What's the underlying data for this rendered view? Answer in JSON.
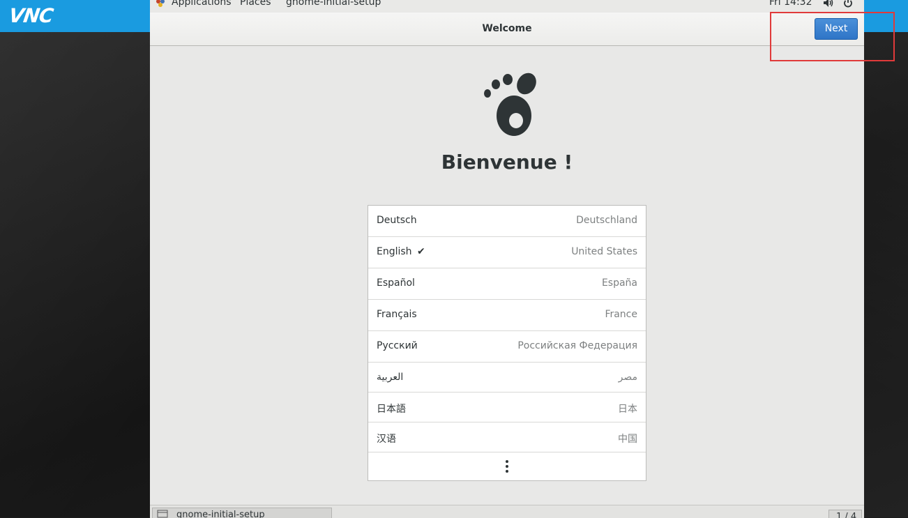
{
  "vnc": {
    "logo": "VNC"
  },
  "top_panel": {
    "applications": "Applications",
    "places": "Places",
    "app_name": "gnome-initial-setup",
    "clock": "Fri 14:32",
    "icons": [
      "applications-icon",
      "volume-icon",
      "power-icon"
    ]
  },
  "window": {
    "title": "Welcome",
    "next_label": "Next"
  },
  "main": {
    "heading": "Bienvenue !",
    "languages": [
      {
        "name": "Deutsch",
        "region": "Deutschland",
        "selected": false
      },
      {
        "name": "English",
        "region": "United States",
        "selected": true
      },
      {
        "name": "Español",
        "region": "España",
        "selected": false
      },
      {
        "name": "Français",
        "region": "France",
        "selected": false
      },
      {
        "name": "Русский",
        "region": "Российская Федерация",
        "selected": false
      },
      {
        "name": "العربية",
        "region": "مصر",
        "selected": false
      },
      {
        "name": "日本語",
        "region": "日本",
        "selected": false
      },
      {
        "name": "汉语",
        "region": "中国",
        "selected": false
      }
    ],
    "selected_mark": "✔"
  },
  "taskbar": {
    "task_label": "gnome-initial-setup",
    "pager": "1 / 4"
  },
  "colors": {
    "vnc_blue": "#1a9be0",
    "next_button": "#3a83d2",
    "highlight": "#e03a3a"
  }
}
